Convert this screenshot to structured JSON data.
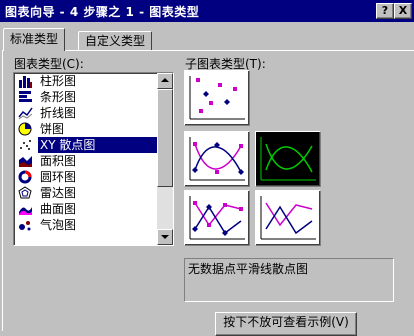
{
  "window": {
    "title": "图表向导 - 4 步骤之 1 - 图表类型",
    "help_button": "?",
    "close_button": "X"
  },
  "tabs": [
    {
      "label": "标准类型",
      "active": true
    },
    {
      "label": "自定义类型",
      "active": false
    }
  ],
  "chart_type_label": "图表类型(C):",
  "chart_types": [
    {
      "label": "柱形图",
      "icon": "column-chart-icon"
    },
    {
      "label": "条形图",
      "icon": "bar-chart-icon"
    },
    {
      "label": "折线图",
      "icon": "line-chart-icon"
    },
    {
      "label": "饼图",
      "icon": "pie-chart-icon"
    },
    {
      "label": "XY 散点图",
      "icon": "scatter-chart-icon",
      "selected": true
    },
    {
      "label": "面积图",
      "icon": "area-chart-icon"
    },
    {
      "label": "圆环图",
      "icon": "doughnut-chart-icon"
    },
    {
      "label": "雷达图",
      "icon": "radar-chart-icon"
    },
    {
      "label": "曲面图",
      "icon": "surface-chart-icon"
    },
    {
      "label": "气泡图",
      "icon": "bubble-chart-icon"
    }
  ],
  "subtype_label": "子图表类型(T):",
  "subtypes": [
    {
      "icon": "scatter-markers-only-icon"
    },
    {
      "icon": "scatter-smooth-lines-markers-icon"
    },
    {
      "icon": "scatter-smooth-lines-no-markers-icon",
      "selected": true
    },
    {
      "icon": "scatter-straight-lines-markers-icon"
    },
    {
      "icon": "scatter-straight-lines-no-markers-icon"
    }
  ],
  "description": "无数据点平滑线散点图",
  "preview_button": "按下不放可查看示例(V)",
  "colors": {
    "title_bar": "#000080",
    "selection": "#000080",
    "dialog": "#c0c0c0",
    "marker": "#cc00cc",
    "marker_dark": "#000080",
    "selected_line": "#00cc00"
  }
}
